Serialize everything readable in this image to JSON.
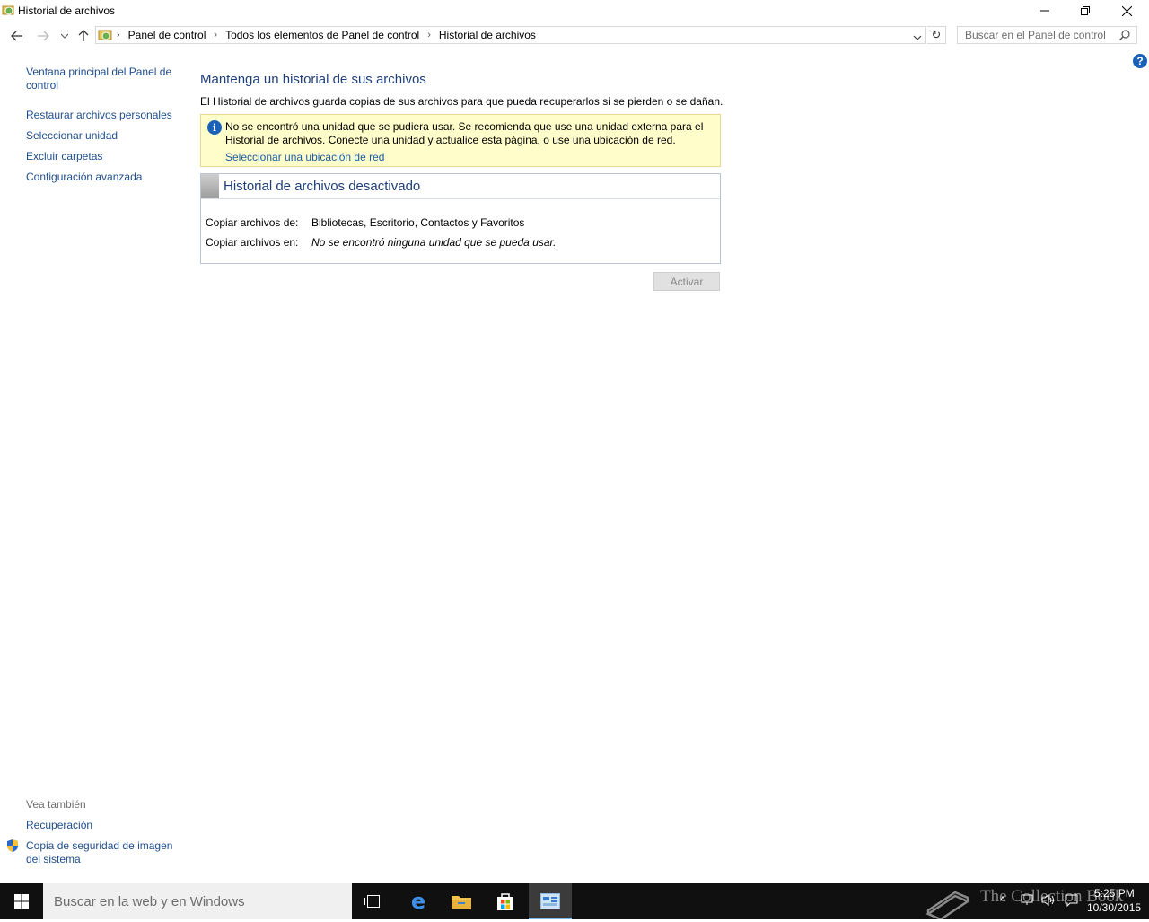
{
  "window": {
    "title": "Historial de archivos"
  },
  "address": {
    "crumbs": [
      "Panel de control",
      "Todos los elementos de Panel de control",
      "Historial de archivos"
    ],
    "search_placeholder": "Buscar en el Panel de control"
  },
  "sidebar": {
    "links": [
      "Ventana principal del Panel de control",
      "Restaurar archivos personales",
      "Seleccionar unidad",
      "Excluir carpetas",
      "Configuración avanzada"
    ],
    "see_also_label": "Vea también",
    "see_also": [
      "Recuperación",
      "Copia de seguridad de imagen del sistema"
    ]
  },
  "main": {
    "title": "Mantenga un historial de sus archivos",
    "description": "El Historial de archivos guarda copias de sus archivos para que pueda recuperarlos si se pierden o se dañan.",
    "warning_text": "No se encontró una unidad que se pudiera usar. Se recomienda que use una unidad externa para el Historial de archivos. Conecte una unidad y actualice esta página, o use una ubicación de red.",
    "warning_link": "Seleccionar una ubicación de red",
    "status_title": "Historial de archivos desactivado",
    "copy_from_label": "Copiar archivos de:",
    "copy_from_value": "Bibliotecas, Escritorio, Contactos y Favoritos",
    "copy_to_label": "Copiar archivos en:",
    "copy_to_value": "No se encontró ninguna unidad que se pueda usar.",
    "activate_label": "Activar"
  },
  "taskbar": {
    "search_placeholder": "Buscar en la web y en Windows",
    "time": "5:25 PM",
    "date": "10/30/2015",
    "watermark": "The Collection Book"
  },
  "colors": {
    "link": "#1f4e8f",
    "heading": "#1e3f7a",
    "warning_bg": "#fffdc9",
    "taskbar": "#101010"
  }
}
